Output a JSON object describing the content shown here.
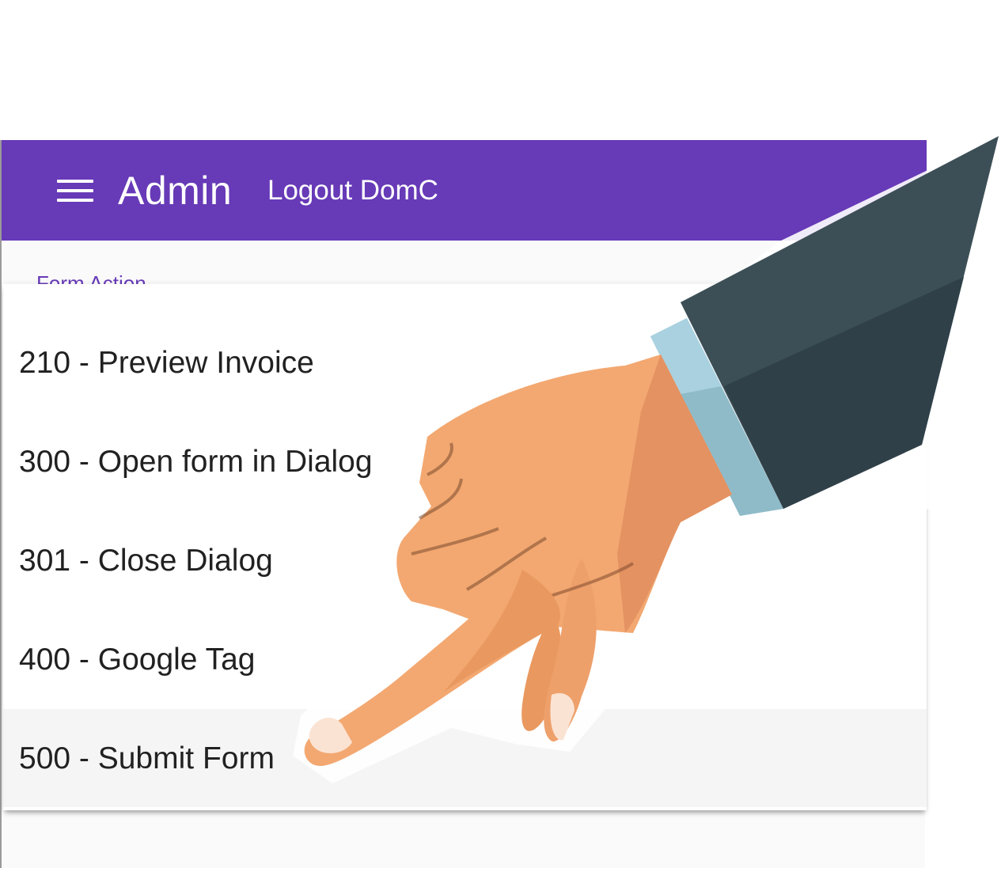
{
  "appbar": {
    "menu_icon": "hamburger-menu-icon",
    "title": "Admin",
    "logout_label": "Logout DomC",
    "color": "#673ab7"
  },
  "field": {
    "label": "Form Action"
  },
  "dropdown": {
    "options": [
      {
        "label": "210 - Preview Invoice"
      },
      {
        "label": "300 - Open form in Dialog"
      },
      {
        "label": "301 - Close Dialog"
      },
      {
        "label": "400 - Google Tag"
      },
      {
        "label": "500 - Submit Form"
      }
    ],
    "selected_index": 4
  },
  "overlay": {
    "illustration": "pointing-hand-icon"
  }
}
